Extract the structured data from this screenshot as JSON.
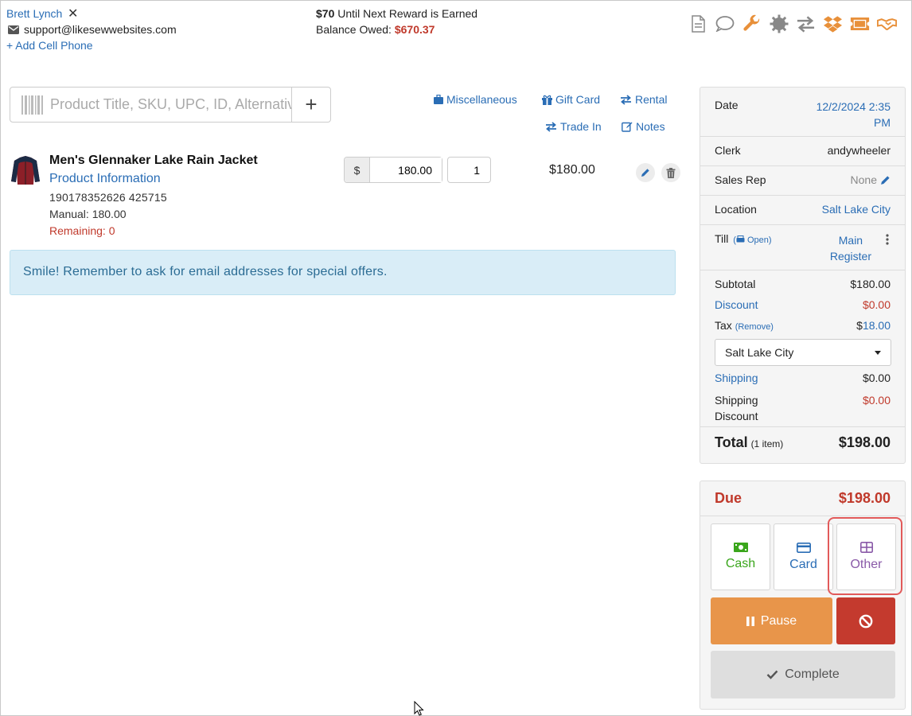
{
  "customer": {
    "name": "Brett Lynch",
    "remove_icon": "close-icon",
    "email": "support@likesewwebsites.com",
    "add_phone": "+ Add Cell Phone"
  },
  "rewards": {
    "amount": "$70",
    "reward_text": " Until Next Reward is Earned",
    "balance_label": "Balance Owed: ",
    "balance_value": "$670.37"
  },
  "toolbar": {
    "icons": [
      "document-icon",
      "chat-icon",
      "wrench-icon",
      "gear-icon",
      "transfer-icon",
      "dropbox-icon",
      "ticket-icon",
      "handshake-icon"
    ]
  },
  "search": {
    "placeholder": "Product Title, SKU, UPC, ID, Alternative",
    "add_label": "+"
  },
  "quick_links": {
    "misc": "Miscellaneous",
    "gift_card": "Gift Card",
    "rental": "Rental",
    "trade_in": "Trade In",
    "notes": "Notes"
  },
  "line_item": {
    "title": "Men's Glennaker Lake Rain Jacket",
    "info_link": "Product Information",
    "codes": "190178352626  425715",
    "manual": "Manual: 180.00",
    "remaining": "Remaining: 0",
    "currency": "$",
    "price": "180.00",
    "qty": "1",
    "total": "$180.00"
  },
  "alert": {
    "message": "Smile! Remember to ask for email addresses for special offers."
  },
  "summary": {
    "date_label": "Date",
    "date_line1": "12/2/2024 2:35",
    "date_line2": "PM",
    "clerk_label": "Clerk",
    "clerk_value": "andywheeler",
    "sales_rep_label": "Sales Rep",
    "sales_rep_value": "None",
    "location_label": "Location",
    "location_value": "Salt Lake City",
    "till_label": "Till",
    "till_status": "Open",
    "till_line1": "Main",
    "till_line2": "Register",
    "subtotal_label": "Subtotal",
    "subtotal_value": "$180.00",
    "discount_label": "Discount",
    "discount_value": "$0.00",
    "tax_label": "Tax",
    "tax_remove": "(Remove)",
    "tax_prefix": "$",
    "tax_value": "18.00",
    "tax_location": "Salt Lake City",
    "shipping_label": "Shipping",
    "shipping_value": "$0.00",
    "ship_disc_line1": "Shipping",
    "ship_disc_line2": "Discount",
    "ship_disc_value": "$0.00",
    "total_label": "Total",
    "total_items": "(1 item)",
    "total_value": "$198.00"
  },
  "payment": {
    "due_label": "Due",
    "due_value": "$198.00",
    "cash_label": "Cash",
    "card_label": "Card",
    "other_label": "Other",
    "pause_label": "Pause",
    "complete_label": "Complete"
  },
  "colors": {
    "accent_blue": "#2a6db5",
    "danger_red": "#c0392b",
    "icon_orange": "#e8903a",
    "cash_green": "#3aa61c",
    "other_purple": "#8a5aa8",
    "pause_orange": "#e8954a"
  }
}
